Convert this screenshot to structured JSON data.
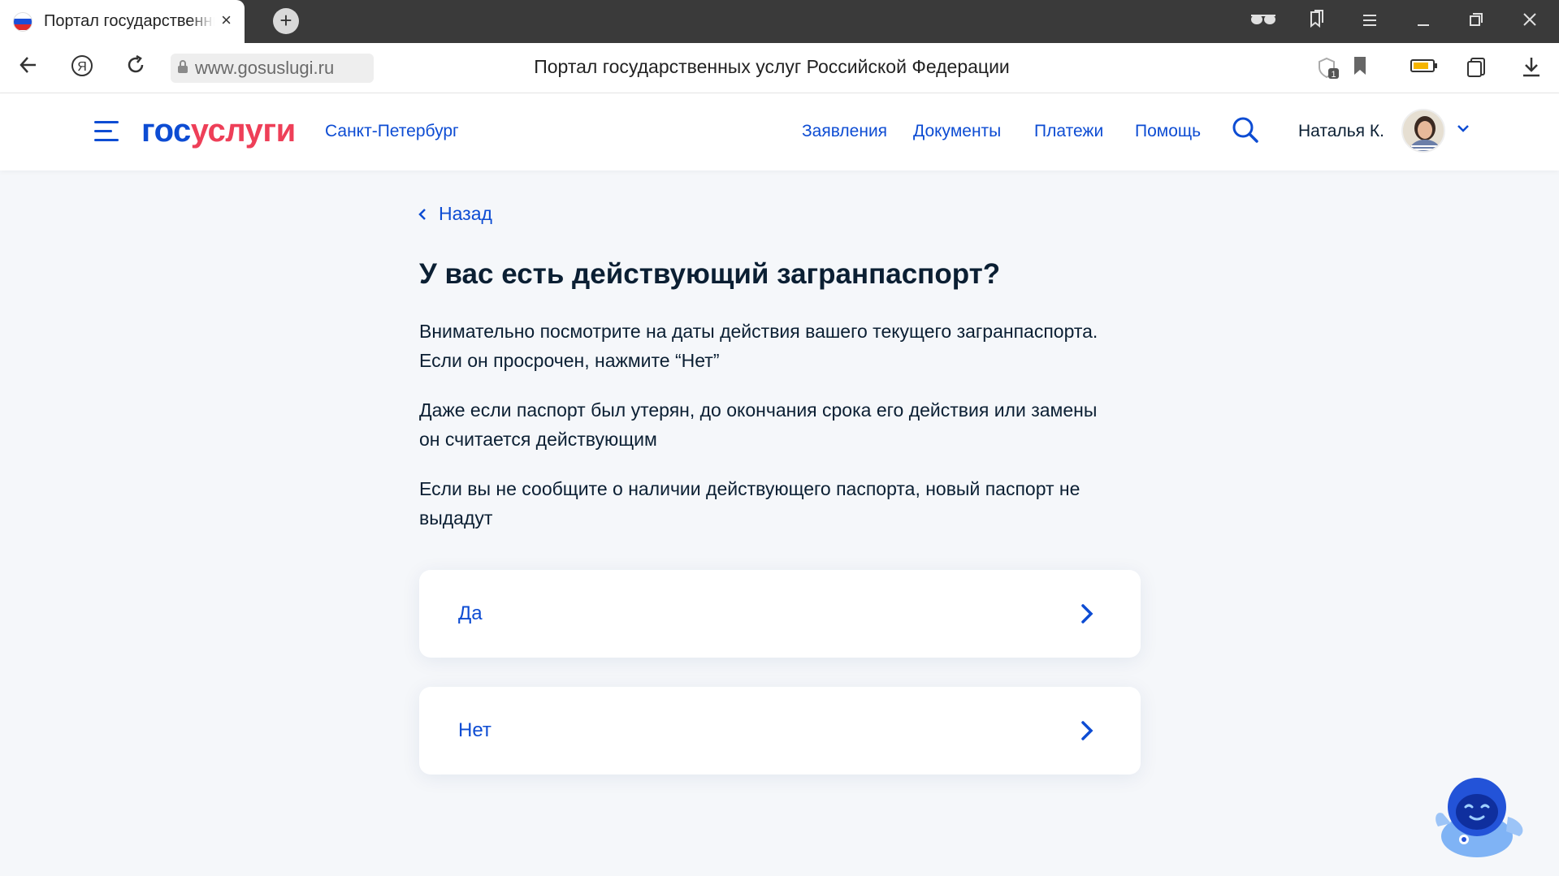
{
  "browser": {
    "tab_title": "Портал государственных услуг Российской Федерации",
    "tab_close": "×",
    "new_tab": "+",
    "url": "www.gosuslugi.ru",
    "page_title": "Портал государственных услуг Российской Федерации",
    "icons": [
      "back-arrow-icon",
      "yandex-icon",
      "reload-icon",
      "lock-icon",
      "protect-icon",
      "bookmark-icon",
      "battery-icon",
      "collections-icon",
      "download-icon",
      "reader-glasses-icon",
      "bookmarks-panel-icon",
      "menu-icon",
      "minimize-icon",
      "restore-icon",
      "close-icon"
    ]
  },
  "site": {
    "logo_part1": "гос",
    "logo_part2": "услуги",
    "region": "Санкт-Петербург",
    "nav": [
      "Заявления",
      "Документы",
      "Платежи",
      "Помощь"
    ],
    "user_name": "Наталья К.",
    "colors": {
      "primary": "#0d4cd3",
      "accent": "#ee3f58",
      "text": "#0b1f33",
      "background": "#f5f7fa"
    }
  },
  "main": {
    "back_label": "Назад",
    "title": "У вас есть действующий загранпаспорт?",
    "paragraphs": [
      [
        "Внимательно посмотрите на даты действия вашего текущего загранпаспорта.",
        "Если он просрочен, нажмите “Нет”"
      ],
      [
        "Даже если паспорт был утерян, до окончания срока его действия или замены",
        "он считается действующим"
      ],
      [
        "Если вы не сообщите о наличии действующего паспорта, новый паспорт не",
        "выдадут"
      ]
    ],
    "options": [
      "Да",
      "Нет"
    ]
  }
}
